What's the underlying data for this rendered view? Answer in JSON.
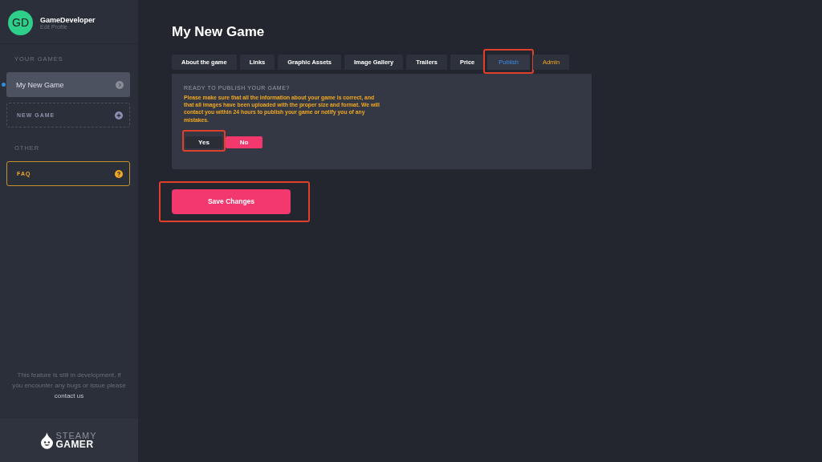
{
  "profile": {
    "initials": "GD",
    "name": "GameDeveloper",
    "subtitle": "Edit Profile"
  },
  "sidebar": {
    "sections": [
      {
        "heading": "YOUR GAMES",
        "items": [
          {
            "kind": "game",
            "label": "My New Game",
            "selected": true
          },
          {
            "kind": "new",
            "label": "NEW GAME",
            "selected": false
          }
        ]
      },
      {
        "heading": "OTHER",
        "items": [
          {
            "kind": "faq",
            "label": "FAQ",
            "selected": false
          }
        ]
      }
    ],
    "notice": {
      "text": "This feature is still in development, if you encounter any bugs or issue please",
      "link": "contact us"
    },
    "logo": {
      "line1": "STEAMY",
      "line2": "GAMER"
    }
  },
  "page_title": "My New Game",
  "tabs": [
    {
      "label": "About the game",
      "selected": false,
      "highlighted": false,
      "kind": "normal"
    },
    {
      "label": "Links",
      "selected": false,
      "highlighted": false,
      "kind": "normal"
    },
    {
      "label": "Graphic Assets",
      "selected": false,
      "highlighted": false,
      "kind": "normal"
    },
    {
      "label": "Image Gallery",
      "selected": false,
      "highlighted": false,
      "kind": "normal"
    },
    {
      "label": "Trailers",
      "selected": false,
      "highlighted": false,
      "kind": "normal"
    },
    {
      "label": "Price",
      "selected": false,
      "highlighted": false,
      "kind": "normal"
    },
    {
      "label": "Publish",
      "selected": true,
      "highlighted": true,
      "kind": "normal"
    },
    {
      "label": "Admin",
      "selected": false,
      "highlighted": false,
      "kind": "admin"
    }
  ],
  "publish": {
    "heading": "READY TO PUBLISH YOUR GAME?",
    "message": "Please make sure that all the information about your game is correct, and that all images have been uploaded with the proper size and format. We will contact you within 24 hours to publish your game or notify you of any mistakes.",
    "options": [
      {
        "label": "Yes",
        "selected": false,
        "highlighted": true
      },
      {
        "label": "No",
        "selected": true,
        "highlighted": false
      }
    ]
  },
  "save_button": {
    "label": "Save Changes",
    "highlighted": true
  }
}
